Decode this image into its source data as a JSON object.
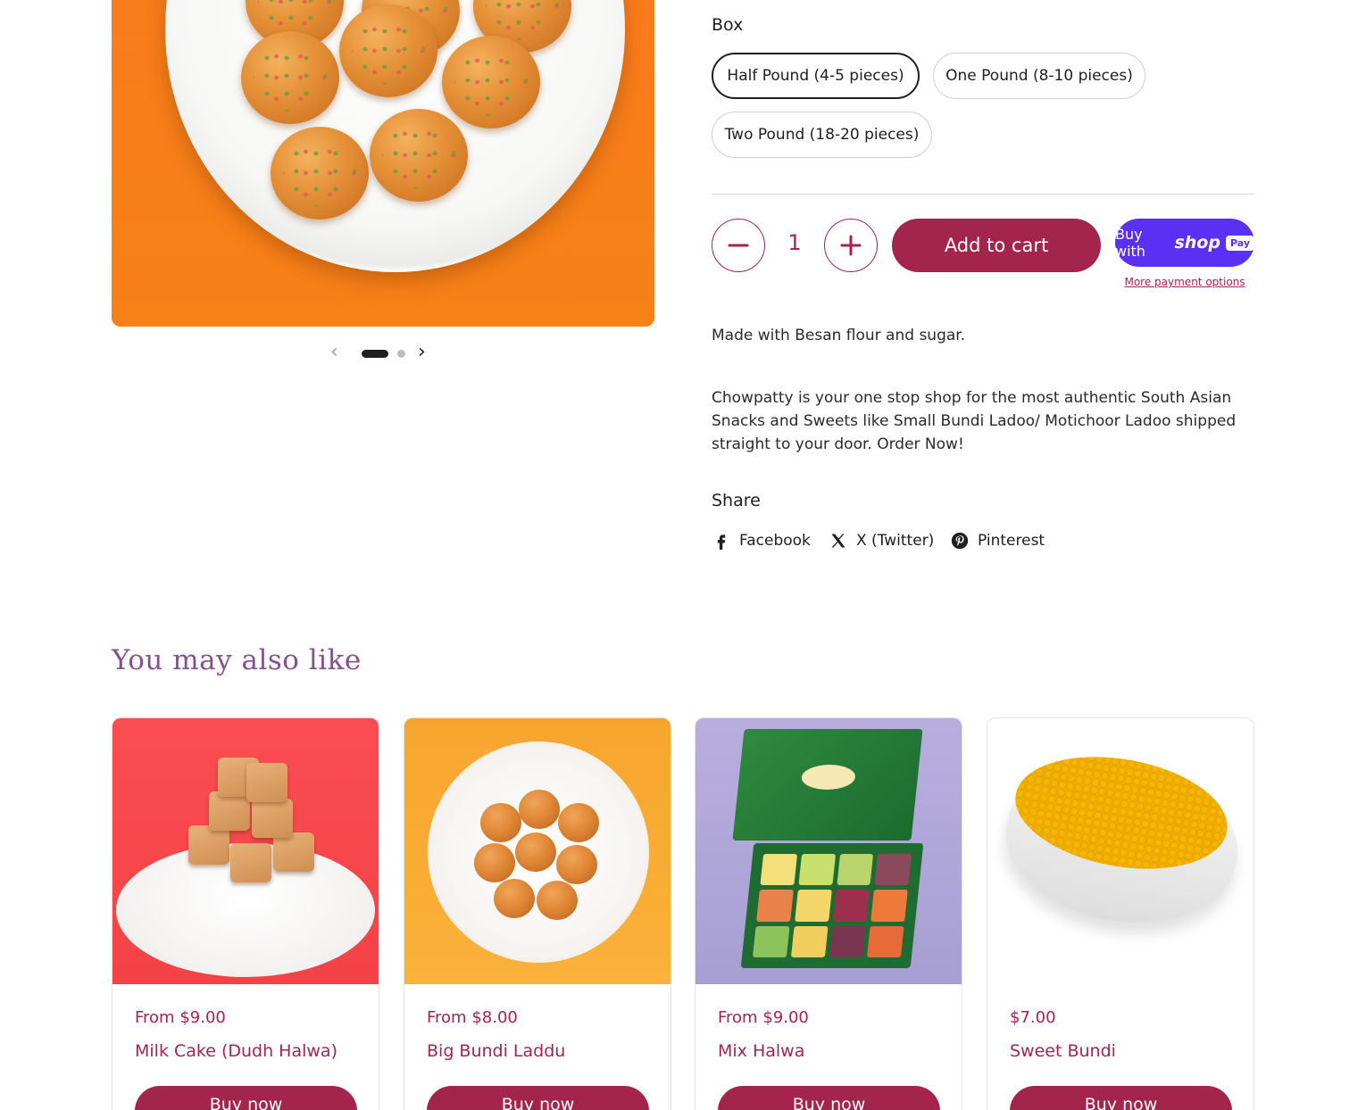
{
  "gallery": {
    "prev_icon": "chevron-left-icon",
    "next_icon": "chevron-right-icon",
    "slide_count": 2,
    "active_slide": 1
  },
  "product": {
    "variant_label": "Box",
    "options": [
      {
        "label": "Half Pound (4-5 pieces)",
        "selected": true
      },
      {
        "label": "One Pound (8-10 pieces)",
        "selected": false
      },
      {
        "label": "Two Pound (18-20 pieces)",
        "selected": false
      }
    ],
    "quantity": "1",
    "decrease_icon": "minus-icon",
    "increase_icon": "plus-icon",
    "add_to_cart": "Add to cart",
    "shop_pay": {
      "prefix": "Buy with",
      "brand": "shop",
      "badge": "Pay"
    },
    "more_payment_options": "More payment options",
    "description_short": "Made with Besan flour and sugar.",
    "description_long": "Chowpatty is your one stop shop for the most authentic South Asian Snacks and Sweets like Small Bundi Ladoo/ Motichoor Ladoo shipped straight to your door. Order Now!"
  },
  "share": {
    "title": "Share",
    "links": [
      {
        "label": "Facebook",
        "icon": "facebook-icon"
      },
      {
        "label": "X (Twitter)",
        "icon": "x-twitter-icon"
      },
      {
        "label": "Pinterest",
        "icon": "pinterest-icon"
      }
    ]
  },
  "recommendations": {
    "title": "You may also like",
    "items": [
      {
        "price": "From $9.00",
        "name": "Milk Cake (Dudh Halwa)",
        "button": "Buy now"
      },
      {
        "price": "From $8.00",
        "name": "Big Bundi Laddu",
        "button": "Buy now"
      },
      {
        "price": "From $9.00",
        "name": "Mix Halwa",
        "button": "Buy now"
      },
      {
        "price": "$7.00",
        "name": "Sweet Bundi",
        "button": "Buy now"
      }
    ]
  },
  "colors": {
    "brand": "#a3244d",
    "heading": "#85518f",
    "shop_pay": "#5a31f4"
  }
}
